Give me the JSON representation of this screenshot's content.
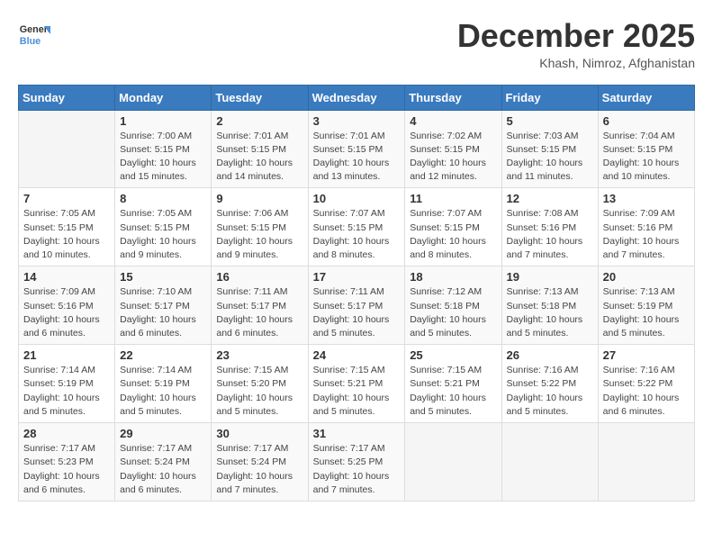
{
  "header": {
    "logo_general": "General",
    "logo_blue": "Blue",
    "month_year": "December 2025",
    "location": "Khash, Nimroz, Afghanistan"
  },
  "days_of_week": [
    "Sunday",
    "Monday",
    "Tuesday",
    "Wednesday",
    "Thursday",
    "Friday",
    "Saturday"
  ],
  "weeks": [
    [
      {
        "day": "",
        "info": ""
      },
      {
        "day": "1",
        "info": "Sunrise: 7:00 AM\nSunset: 5:15 PM\nDaylight: 10 hours\nand 15 minutes."
      },
      {
        "day": "2",
        "info": "Sunrise: 7:01 AM\nSunset: 5:15 PM\nDaylight: 10 hours\nand 14 minutes."
      },
      {
        "day": "3",
        "info": "Sunrise: 7:01 AM\nSunset: 5:15 PM\nDaylight: 10 hours\nand 13 minutes."
      },
      {
        "day": "4",
        "info": "Sunrise: 7:02 AM\nSunset: 5:15 PM\nDaylight: 10 hours\nand 12 minutes."
      },
      {
        "day": "5",
        "info": "Sunrise: 7:03 AM\nSunset: 5:15 PM\nDaylight: 10 hours\nand 11 minutes."
      },
      {
        "day": "6",
        "info": "Sunrise: 7:04 AM\nSunset: 5:15 PM\nDaylight: 10 hours\nand 10 minutes."
      }
    ],
    [
      {
        "day": "7",
        "info": "Sunrise: 7:05 AM\nSunset: 5:15 PM\nDaylight: 10 hours\nand 10 minutes."
      },
      {
        "day": "8",
        "info": "Sunrise: 7:05 AM\nSunset: 5:15 PM\nDaylight: 10 hours\nand 9 minutes."
      },
      {
        "day": "9",
        "info": "Sunrise: 7:06 AM\nSunset: 5:15 PM\nDaylight: 10 hours\nand 9 minutes."
      },
      {
        "day": "10",
        "info": "Sunrise: 7:07 AM\nSunset: 5:15 PM\nDaylight: 10 hours\nand 8 minutes."
      },
      {
        "day": "11",
        "info": "Sunrise: 7:07 AM\nSunset: 5:15 PM\nDaylight: 10 hours\nand 8 minutes."
      },
      {
        "day": "12",
        "info": "Sunrise: 7:08 AM\nSunset: 5:16 PM\nDaylight: 10 hours\nand 7 minutes."
      },
      {
        "day": "13",
        "info": "Sunrise: 7:09 AM\nSunset: 5:16 PM\nDaylight: 10 hours\nand 7 minutes."
      }
    ],
    [
      {
        "day": "14",
        "info": "Sunrise: 7:09 AM\nSunset: 5:16 PM\nDaylight: 10 hours\nand 6 minutes."
      },
      {
        "day": "15",
        "info": "Sunrise: 7:10 AM\nSunset: 5:17 PM\nDaylight: 10 hours\nand 6 minutes."
      },
      {
        "day": "16",
        "info": "Sunrise: 7:11 AM\nSunset: 5:17 PM\nDaylight: 10 hours\nand 6 minutes."
      },
      {
        "day": "17",
        "info": "Sunrise: 7:11 AM\nSunset: 5:17 PM\nDaylight: 10 hours\nand 5 minutes."
      },
      {
        "day": "18",
        "info": "Sunrise: 7:12 AM\nSunset: 5:18 PM\nDaylight: 10 hours\nand 5 minutes."
      },
      {
        "day": "19",
        "info": "Sunrise: 7:13 AM\nSunset: 5:18 PM\nDaylight: 10 hours\nand 5 minutes."
      },
      {
        "day": "20",
        "info": "Sunrise: 7:13 AM\nSunset: 5:19 PM\nDaylight: 10 hours\nand 5 minutes."
      }
    ],
    [
      {
        "day": "21",
        "info": "Sunrise: 7:14 AM\nSunset: 5:19 PM\nDaylight: 10 hours\nand 5 minutes."
      },
      {
        "day": "22",
        "info": "Sunrise: 7:14 AM\nSunset: 5:19 PM\nDaylight: 10 hours\nand 5 minutes."
      },
      {
        "day": "23",
        "info": "Sunrise: 7:15 AM\nSunset: 5:20 PM\nDaylight: 10 hours\nand 5 minutes."
      },
      {
        "day": "24",
        "info": "Sunrise: 7:15 AM\nSunset: 5:21 PM\nDaylight: 10 hours\nand 5 minutes."
      },
      {
        "day": "25",
        "info": "Sunrise: 7:15 AM\nSunset: 5:21 PM\nDaylight: 10 hours\nand 5 minutes."
      },
      {
        "day": "26",
        "info": "Sunrise: 7:16 AM\nSunset: 5:22 PM\nDaylight: 10 hours\nand 5 minutes."
      },
      {
        "day": "27",
        "info": "Sunrise: 7:16 AM\nSunset: 5:22 PM\nDaylight: 10 hours\nand 6 minutes."
      }
    ],
    [
      {
        "day": "28",
        "info": "Sunrise: 7:17 AM\nSunset: 5:23 PM\nDaylight: 10 hours\nand 6 minutes."
      },
      {
        "day": "29",
        "info": "Sunrise: 7:17 AM\nSunset: 5:24 PM\nDaylight: 10 hours\nand 6 minutes."
      },
      {
        "day": "30",
        "info": "Sunrise: 7:17 AM\nSunset: 5:24 PM\nDaylight: 10 hours\nand 7 minutes."
      },
      {
        "day": "31",
        "info": "Sunrise: 7:17 AM\nSunset: 5:25 PM\nDaylight: 10 hours\nand 7 minutes."
      },
      {
        "day": "",
        "info": ""
      },
      {
        "day": "",
        "info": ""
      },
      {
        "day": "",
        "info": ""
      }
    ]
  ]
}
